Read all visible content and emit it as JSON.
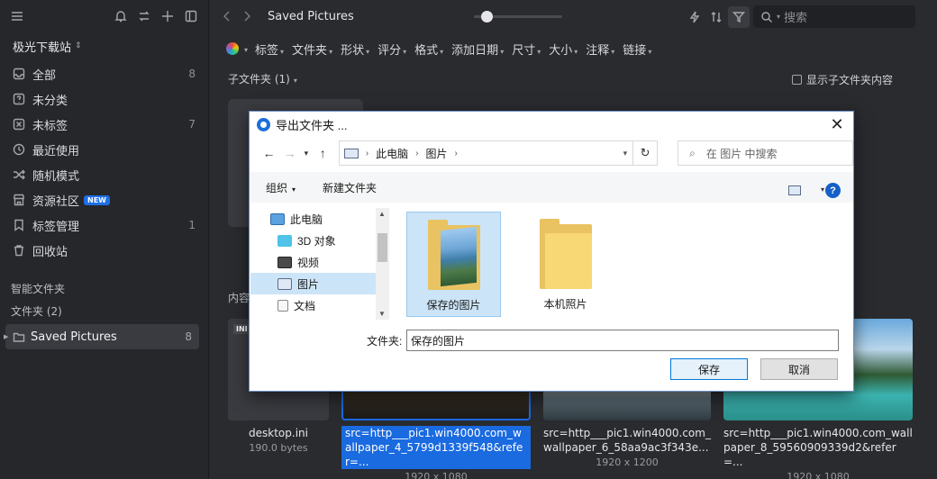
{
  "sidebar": {
    "library_name": "极光下载站",
    "items": [
      {
        "label": "全部",
        "count": "8",
        "icon": "inbox-icon"
      },
      {
        "label": "未分类",
        "count": "",
        "icon": "question-box-icon"
      },
      {
        "label": "未标签",
        "count": "7",
        "icon": "tag-off-icon"
      },
      {
        "label": "最近使用",
        "count": "",
        "icon": "clock-icon"
      },
      {
        "label": "随机模式",
        "count": "",
        "icon": "shuffle-icon"
      },
      {
        "label": "资源社区",
        "count": "",
        "icon": "store-icon",
        "badge": "NEW"
      },
      {
        "label": "标签管理",
        "count": "1",
        "icon": "bookmark-icon"
      },
      {
        "label": "回收站",
        "count": "",
        "icon": "trash-icon"
      }
    ],
    "smart_folders": "智能文件夹",
    "folders_heading": "文件夹 (2)",
    "folder": {
      "label": "Saved Pictures",
      "count": "8"
    }
  },
  "toolbar": {
    "title": "Saved Pictures",
    "search_placeholder": "搜索",
    "zoom_fraction": 0.08
  },
  "filters": [
    "标签",
    "文件夹",
    "形状",
    "评分",
    "格式",
    "添加日期",
    "尺寸",
    "大小",
    "注释",
    "链接"
  ],
  "content": {
    "subfolders_label": "子文件夹 (1)",
    "show_subfolder_content": "显示子文件夹内容",
    "content_label": "内容"
  },
  "thumbnails": [
    {
      "name": "desktop.ini",
      "meta": "190.0 bytes",
      "tag": "INI"
    },
    {
      "name": "src=http___pic1.win4000.com_wallpaper_4_5799d1339f548&refer=...",
      "meta": "1920 x 1080",
      "selected": true
    },
    {
      "name": "src=http___pic1.win4000.com_wallpaper_6_58aa9ac3f343e...",
      "meta": "1920 x 1200"
    },
    {
      "name": "src=http___pic1.win4000.com_wallpaper_8_59560909339d2&refer=...",
      "meta": "1920 x 1080"
    }
  ],
  "dialog": {
    "title": "导出文件夹 ...",
    "breadcrumb": [
      "此电脑",
      "图片"
    ],
    "search_placeholder": "在 图片 中搜索",
    "organize": "组织",
    "new_folder": "新建文件夹",
    "tree": [
      {
        "label": "此电脑",
        "icon": "computer-icon"
      },
      {
        "label": "3D 对象",
        "icon": "cube-icon"
      },
      {
        "label": "视频",
        "icon": "film-icon"
      },
      {
        "label": "图片",
        "icon": "picture-icon",
        "selected": true
      },
      {
        "label": "文档",
        "icon": "document-icon"
      }
    ],
    "files": [
      {
        "label": "保存的图片",
        "selected": true
      },
      {
        "label": "本机照片",
        "selected": false
      }
    ],
    "folder_label": "文件夹:",
    "folder_value": "保存的图片",
    "save": "保存",
    "cancel": "取消"
  }
}
